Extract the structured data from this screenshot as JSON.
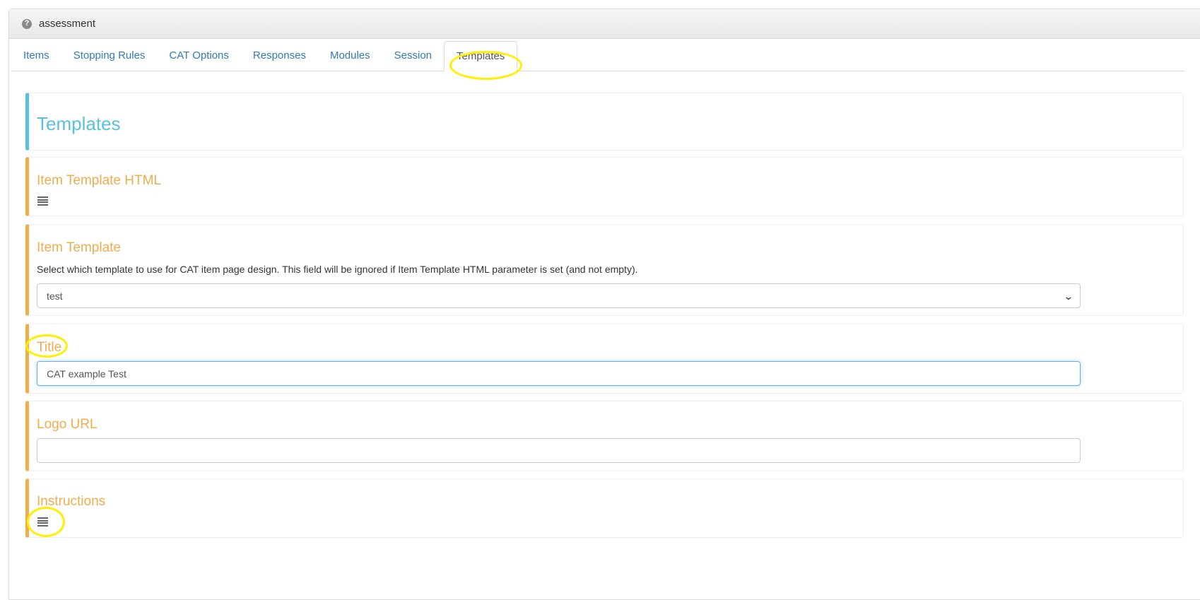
{
  "panel": {
    "title": "assessment",
    "help_icon": "?"
  },
  "tabs": [
    {
      "label": "Items",
      "active": false
    },
    {
      "label": "Stopping Rules",
      "active": false
    },
    {
      "label": "CAT Options",
      "active": false
    },
    {
      "label": "Responses",
      "active": false
    },
    {
      "label": "Modules",
      "active": false
    },
    {
      "label": "Session",
      "active": false
    },
    {
      "label": "Templates",
      "active": true
    }
  ],
  "section_title": "Templates",
  "fields": {
    "item_template_html": {
      "label": "Item Template HTML",
      "icon": "text-lines-icon"
    },
    "item_template": {
      "label": "Item Template",
      "help": "Select which template to use for CAT item page design. This field will be ignored if Item Template HTML parameter is set (and not empty).",
      "selected": "test"
    },
    "title": {
      "label": "Title",
      "value": "CAT example Test"
    },
    "logo_url": {
      "label": "Logo URL",
      "value": ""
    },
    "instructions": {
      "label": "Instructions",
      "icon": "text-lines-icon"
    }
  },
  "colors": {
    "info_accent": "#5bc0de",
    "warning_accent": "#f0ad4e",
    "link": "#337ab7",
    "highlight": "#ffef00"
  }
}
